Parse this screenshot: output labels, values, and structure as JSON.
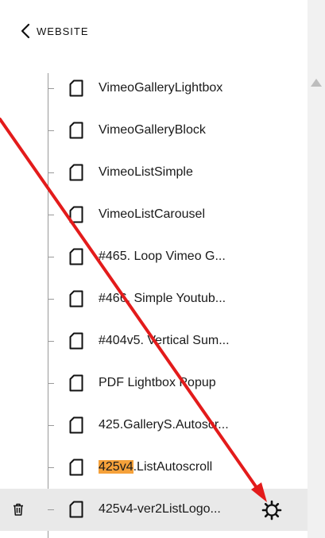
{
  "header": {
    "back_label": "WEBSITE"
  },
  "pages": [
    {
      "label": "VimeoGalleryLightbox",
      "icon": "page-icon"
    },
    {
      "label": "VimeoGalleryBlock",
      "icon": "page-icon"
    },
    {
      "label": "VimeoListSimple",
      "icon": "page-icon"
    },
    {
      "label": "VimeoListCarousel",
      "icon": "page-icon"
    },
    {
      "label": "#465. Loop Vimeo G...",
      "icon": "page-icon"
    },
    {
      "label": "#466. Simple Youtub...",
      "icon": "page-icon"
    },
    {
      "label": "#404v5. Vertical Sum...",
      "icon": "page-icon"
    },
    {
      "label": "PDF Lightbox Popup",
      "icon": "page-icon"
    },
    {
      "label": "425.GalleryS.Autoscr...",
      "icon": "page-icon"
    },
    {
      "label_highlight": "425v4",
      "label_rest": ".ListAutoscroll",
      "icon": "page-icon"
    },
    {
      "label": "425v4-ver2ListLogo...",
      "icon": "page-icon",
      "selected": true,
      "actions": [
        "trash-icon",
        "gear-icon"
      ]
    }
  ],
  "colors": {
    "highlight": "#f5a13a",
    "selected_row": "#e9e9e9",
    "annotation_arrow": "#e31b1b"
  }
}
